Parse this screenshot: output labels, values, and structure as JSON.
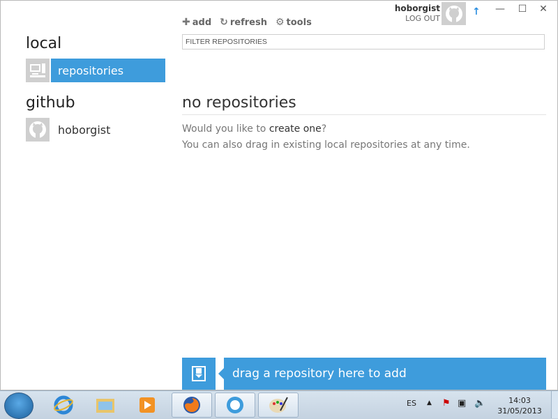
{
  "toolbar": {
    "add_label": "add",
    "refresh_label": "refresh",
    "tools_label": "tools"
  },
  "filter": {
    "placeholder": "FILTER REPOSITORIES"
  },
  "user": {
    "name": "hoborgist",
    "logout_label": "LOG OUT"
  },
  "sidebar": {
    "local_title": "local",
    "local_items": [
      {
        "label": "repositories",
        "icon": "computer-icon",
        "active": true
      }
    ],
    "github_title": "github",
    "github_items": [
      {
        "label": "hoborgist",
        "icon": "octocat-icon"
      }
    ]
  },
  "main": {
    "empty_title": "no repositories",
    "line1_prefix": "Would you like to ",
    "line1_link": "create one",
    "line1_suffix": "?",
    "line2": "You can also drag in existing local repositories at any time."
  },
  "dropzone": {
    "label": "drag a repository here to add"
  },
  "taskbar": {
    "language": "ES",
    "time": "14:03",
    "date": "31/05/2013",
    "apps": [
      "internet-explorer-icon",
      "windows-explorer-icon",
      "media-player-icon",
      "firefox-icon",
      "github-icon",
      "paint-icon"
    ]
  },
  "colors": {
    "accent": "#3e9cdc",
    "sync": "#2d8fe0"
  }
}
